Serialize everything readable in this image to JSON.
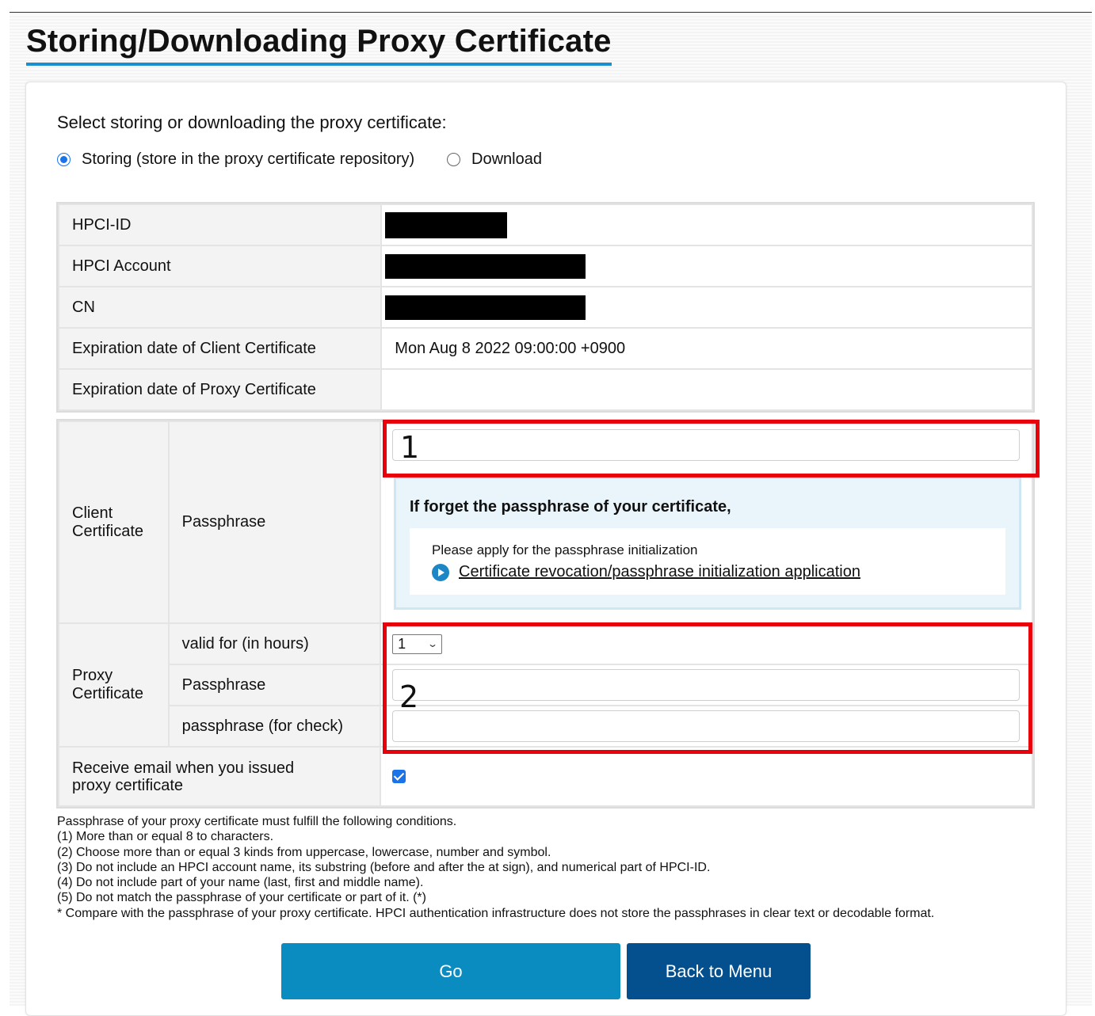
{
  "page_title": "Storing/Downloading Proxy Certificate",
  "mode_prompt": "Select storing or downloading the proxy certificate:",
  "mode_options": [
    {
      "label": "Storing (store in the proxy certificate repository)",
      "selected": true
    },
    {
      "label": "Download",
      "selected": false
    }
  ],
  "info_table": {
    "hpci_id_label": "HPCI-ID",
    "hpci_account_label": "HPCI Account",
    "cn_label": "CN",
    "client_exp_label": "Expiration date of Client Certificate",
    "client_exp_value": "Mon Aug 8 2022 09:00:00 +0900",
    "proxy_exp_label": "Expiration date of Proxy Certificate",
    "proxy_exp_value": ""
  },
  "form_table": {
    "client_cert_label": "Client Certificate",
    "client_passphrase_label": "Passphrase",
    "client_passphrase_value": "",
    "forget_title": "If forget the passphrase of your certificate,",
    "forget_text": "Please apply for the passphrase initialization",
    "forget_link": "Certificate revocation/passphrase initialization application",
    "proxy_cert_label": "Proxy Certificate",
    "valid_for_label": "valid for (in hours)",
    "valid_for_value": "1",
    "proxy_passphrase_label": "Passphrase",
    "proxy_passphrase_value": "",
    "proxy_passphrase_check_label": "passphrase (for check)",
    "proxy_passphrase_check_value": "",
    "email_label": "Receive email when you issued proxy certificate",
    "email_checked": true
  },
  "annotations": {
    "box1_label": "1",
    "box2_label": "2"
  },
  "conditions": [
    "Passphrase of your proxy certificate must fulfill the following conditions.",
    "(1) More than or equal 8 to characters.",
    "(2) Choose more than or equal 3 kinds from uppercase, lowercase, number and symbol.",
    "(3) Do not include an HPCI account name, its substring (before and after the at sign), and numerical part of HPCI-ID.",
    "(4) Do not include part of your name (last, first and middle name).",
    "(5) Do not match the passphrase of your certificate or part of it. (*)",
    "* Compare with the passphrase of your proxy certificate. HPCI authentication infrastructure does not store the passphrases in clear text or decodable format."
  ],
  "buttons": {
    "go": "Go",
    "back": "Back to Menu"
  },
  "colors": {
    "title_underline": "#1a8fd0",
    "go_button": "#0b8cc1",
    "back_button": "#04508f",
    "annotation_red": "#e8000b"
  }
}
